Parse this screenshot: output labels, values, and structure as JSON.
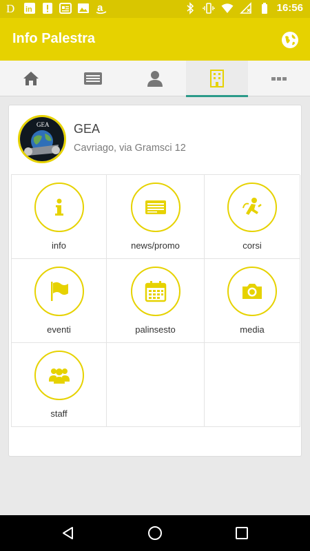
{
  "status_bar": {
    "time": "16:56",
    "left_icons": [
      "dailymotion-icon",
      "linkedin-icon",
      "alert-icon",
      "news-icon",
      "image-icon",
      "amazon-icon"
    ],
    "right_icons": [
      "bluetooth-icon",
      "vibrate-icon",
      "wifi-icon",
      "no-signal-icon",
      "battery-icon"
    ],
    "left_glyphs": [
      "D",
      "in",
      "!",
      "",
      "",
      "a"
    ]
  },
  "app_bar": {
    "title": "Info Palestra",
    "action_icon": "globe-icon"
  },
  "tabs": [
    {
      "icon": "home-icon",
      "active": false
    },
    {
      "icon": "news-card-icon",
      "active": false
    },
    {
      "icon": "user-icon",
      "active": false
    },
    {
      "icon": "building-icon",
      "active": true
    },
    {
      "icon": "more-icon",
      "active": false
    }
  ],
  "gym": {
    "name": "GEA",
    "address": "Cavriago, via Gramsci 12",
    "logo_text": "GEA"
  },
  "menu": [
    {
      "label": "info",
      "icon": "info-icon"
    },
    {
      "label": "news/promo",
      "icon": "newspaper-icon"
    },
    {
      "label": "corsi",
      "icon": "fitness-icon"
    },
    {
      "label": "eventi",
      "icon": "flag-icon"
    },
    {
      "label": "palinsesto",
      "icon": "calendar-icon"
    },
    {
      "label": "media",
      "icon": "camera-icon"
    },
    {
      "label": "staff",
      "icon": "group-icon"
    }
  ],
  "colors": {
    "accent": "#e6d200",
    "status_bar": "#d9c600",
    "tab_indicator": "#2b9a89"
  }
}
